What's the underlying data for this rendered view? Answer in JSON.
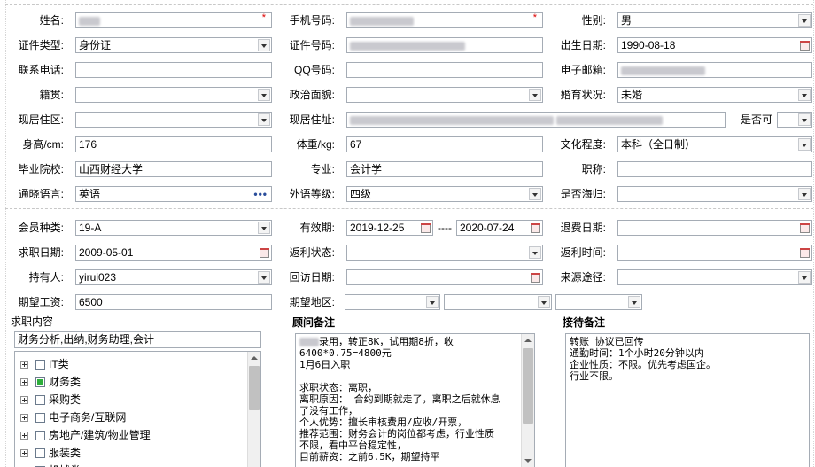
{
  "form": {
    "row1": {
      "name_label": "姓名:",
      "name_value": "",
      "phone_label": "手机号码:",
      "phone_value": "",
      "required_mark": "*",
      "gender_label": "性别:",
      "gender_value": "男"
    },
    "row2": {
      "id_type_label": "证件类型:",
      "id_type_value": "身份证",
      "id_no_label": "证件号码:",
      "id_no_value": "",
      "birth_label": "出生日期:",
      "birth_value": "1990-08-18"
    },
    "row3": {
      "tel_label": "联系电话:",
      "tel_value": "",
      "qq_label": "QQ号码:",
      "qq_value": "",
      "email_label": "电子邮箱:",
      "email_value": ""
    },
    "row4": {
      "native_label": "籍贯:",
      "native_value": "",
      "political_label": "政治面貌:",
      "political_value": "",
      "marital_label": "婚育状况:",
      "marital_value": "未婚"
    },
    "row5": {
      "region_label": "现居住区:",
      "region_value": "",
      "address_label": "现居住址:",
      "address_value": "",
      "yesno_label": "是否可",
      "yesno_value": ""
    },
    "row6": {
      "height_label": "身高/cm:",
      "height_value": "176",
      "weight_label": "体重/kg:",
      "weight_value": "67",
      "edu_label": "文化程度:",
      "edu_value": "本科（全日制）"
    },
    "row7": {
      "school_label": "毕业院校:",
      "school_value": "山西财经大学",
      "major_label": "专业:",
      "major_value": "会计学",
      "title_label": "职称:",
      "title_value": ""
    },
    "row8": {
      "lang_label": "通晓语言:",
      "lang_value": "英语",
      "lang_level_label": "外语等级:",
      "lang_level_value": "四级",
      "overseas_label": "是否海归:",
      "overseas_value": ""
    },
    "row9": {
      "member_label": "会员种类:",
      "member_value": "19-A",
      "valid_label": "有效期:",
      "valid_from": "2019-12-25",
      "valid_sep": "----",
      "valid_to": "2020-07-24",
      "refund_label": "退费日期:",
      "refund_value": ""
    },
    "row10": {
      "job_date_label": "求职日期:",
      "job_date_value": "2009-05-01",
      "rebate_status_label": "返利状态:",
      "rebate_status_value": "",
      "rebate_time_label": "返利时间:",
      "rebate_time_value": ""
    },
    "row11": {
      "holder_label": "持有人:",
      "holder_value": "yirui023",
      "visit_label": "回访日期:",
      "visit_value": "",
      "source_label": "来源途径:",
      "source_value": ""
    },
    "row12": {
      "salary_label": "期望工资:",
      "salary_value": "6500",
      "area_label": "期望地区:"
    }
  },
  "job_panel": {
    "title": "求职内容",
    "summary": "财务分析,出纳,财务助理,会计",
    "tree": [
      {
        "label": "IT类",
        "checked": false
      },
      {
        "label": "财务类",
        "checked": true
      },
      {
        "label": "采购类",
        "checked": false
      },
      {
        "label": "电子商务/互联网",
        "checked": false
      },
      {
        "label": "房地产/建筑/物业管理",
        "checked": false
      },
      {
        "label": "服装类",
        "checked": false
      },
      {
        "label": "机械类",
        "checked": false
      }
    ]
  },
  "advisor_panel": {
    "title": "顾问备注",
    "lines": [
      "录用，转正8K，试用期8折，收",
      "6400*0.75=4800元",
      "1月6日入职",
      "",
      "求职状态：离职，",
      "离职原因： 合约到期就走了，离职之后就休息",
      "了没有工作，",
      "个人优势：擅长审核费用/应收/开票，",
      "推荐范围：财务会计的岗位都考虑，行业性质",
      "不限，看中平台稳定性，",
      "目前薪资：之前6.5K，期望持平"
    ]
  },
  "reception_panel": {
    "title": "接待备注",
    "lines": [
      "转账 协议已回传",
      "通勤时间：1个小时20分钟以内",
      "企业性质：不限。优先考虑国企。",
      "行业不限。"
    ]
  }
}
